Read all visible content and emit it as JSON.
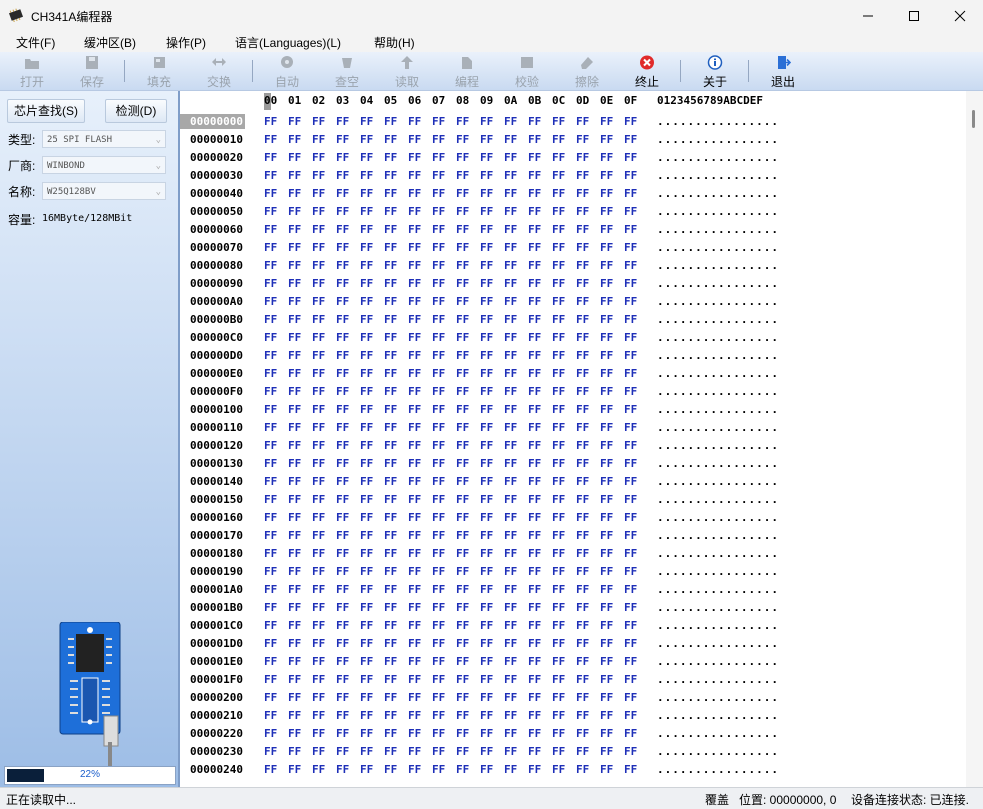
{
  "window": {
    "title": "CH341A编程器"
  },
  "menu": [
    "文件(F)",
    "缓冲区(B)",
    "操作(P)",
    "语言(Languages)(L)",
    "帮助(H)"
  ],
  "toolbar": [
    {
      "label": "打开",
      "icon": "open-icon",
      "enabled": false
    },
    {
      "label": "保存",
      "icon": "save-icon",
      "enabled": false
    },
    {
      "label": "填充",
      "icon": "fill-icon",
      "enabled": false
    },
    {
      "label": "交换",
      "icon": "swap-icon",
      "enabled": false
    },
    {
      "label": "自动",
      "icon": "auto-icon",
      "enabled": false
    },
    {
      "label": "查空",
      "icon": "blank-check-icon",
      "enabled": false
    },
    {
      "label": "读取",
      "icon": "read-icon",
      "enabled": false
    },
    {
      "label": "编程",
      "icon": "program-icon",
      "enabled": false
    },
    {
      "label": "校验",
      "icon": "verify-icon",
      "enabled": false
    },
    {
      "label": "擦除",
      "icon": "erase-icon",
      "enabled": false
    },
    {
      "label": "终止",
      "icon": "stop-icon",
      "enabled": true
    },
    {
      "label": "关于",
      "icon": "info-icon",
      "enabled": true
    },
    {
      "label": "退出",
      "icon": "exit-icon",
      "enabled": true
    }
  ],
  "panel": {
    "search_button": "芯片查找(S)",
    "detect_button": "检测(D)",
    "type_label": "类型:",
    "type_value": "25 SPI FLASH",
    "vendor_label": "厂商:",
    "vendor_value": "WINBOND",
    "name_label": "名称:",
    "name_value": "W25Q128BV",
    "capacity_label": "容量:",
    "capacity_value": "16MByte/128MBit",
    "progress_text": "22%",
    "progress_fraction": 0.22
  },
  "hex": {
    "columns": [
      "00",
      "01",
      "02",
      "03",
      "04",
      "05",
      "06",
      "07",
      "08",
      "09",
      "0A",
      "0B",
      "0C",
      "0D",
      "0E",
      "0F"
    ],
    "ascii_header": "0123456789ABCDEF",
    "addresses": [
      "00000000",
      "00000010",
      "00000020",
      "00000030",
      "00000040",
      "00000050",
      "00000060",
      "00000070",
      "00000080",
      "00000090",
      "000000A0",
      "000000B0",
      "000000C0",
      "000000D0",
      "000000E0",
      "000000F0",
      "00000100",
      "00000110",
      "00000120",
      "00000130",
      "00000140",
      "00000150",
      "00000160",
      "00000170",
      "00000180",
      "00000190",
      "000001A0",
      "000001B0",
      "000001C0",
      "000001D0",
      "000001E0",
      "000001F0",
      "00000200",
      "00000210",
      "00000220",
      "00000230",
      "00000240"
    ],
    "byte_value": "FF",
    "ascii_row": "................"
  },
  "status": {
    "left": "正在读取中...",
    "mode": "覆盖",
    "position": "位置: 00000000, 0",
    "connection": "设备连接状态: 已连接."
  }
}
